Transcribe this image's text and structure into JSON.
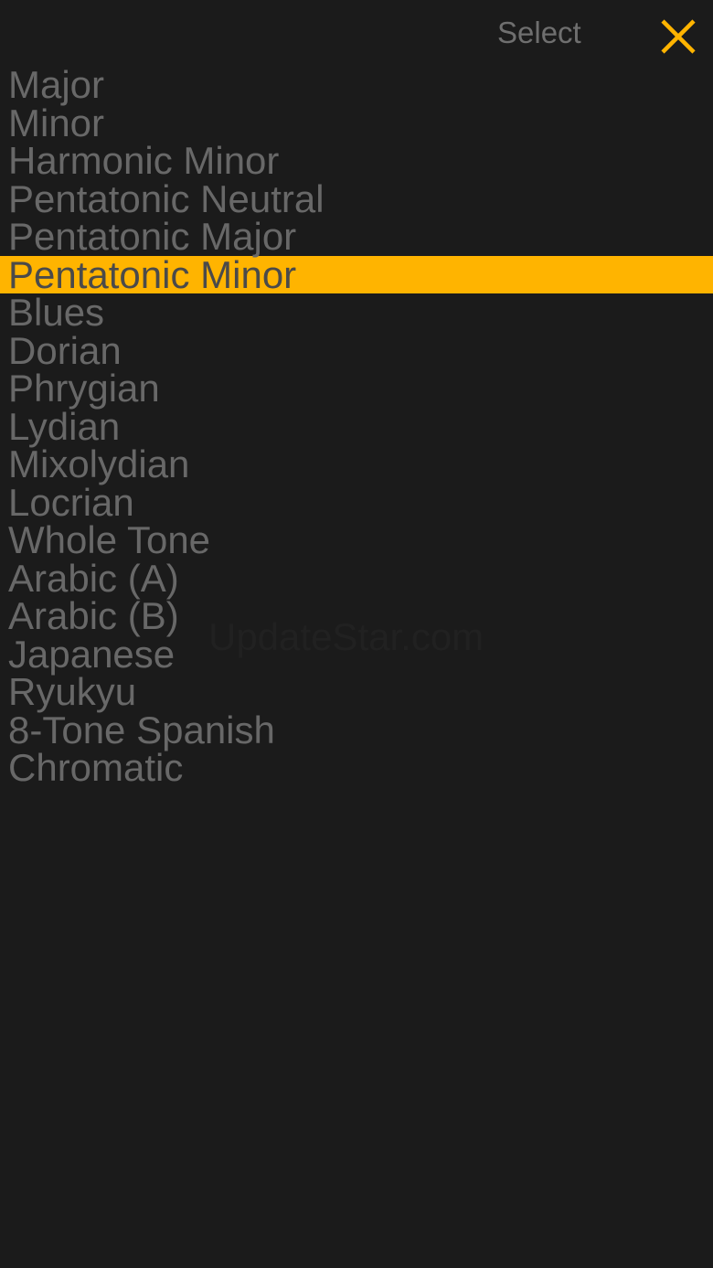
{
  "header": {
    "select_label": "Select",
    "close_icon": "close-icon",
    "accent_color": "#ffb400"
  },
  "scales": {
    "selected": "Pentatonic Minor",
    "items": [
      "Major",
      "Minor",
      "Harmonic Minor",
      "Pentatonic Neutral",
      "Pentatonic Major",
      "Pentatonic Minor",
      "Blues",
      "Dorian",
      "Phrygian",
      "Lydian",
      "Mixolydian",
      "Locrian",
      "Whole Tone",
      "Arabic (A)",
      "Arabic (B)",
      "Japanese",
      "Ryukyu",
      "8-Tone Spanish",
      "Chromatic"
    ]
  },
  "watermark": "UpdateStar.com",
  "colors": {
    "background": "#1b1b1b",
    "text": "#686868",
    "highlight": "#ffb400"
  }
}
